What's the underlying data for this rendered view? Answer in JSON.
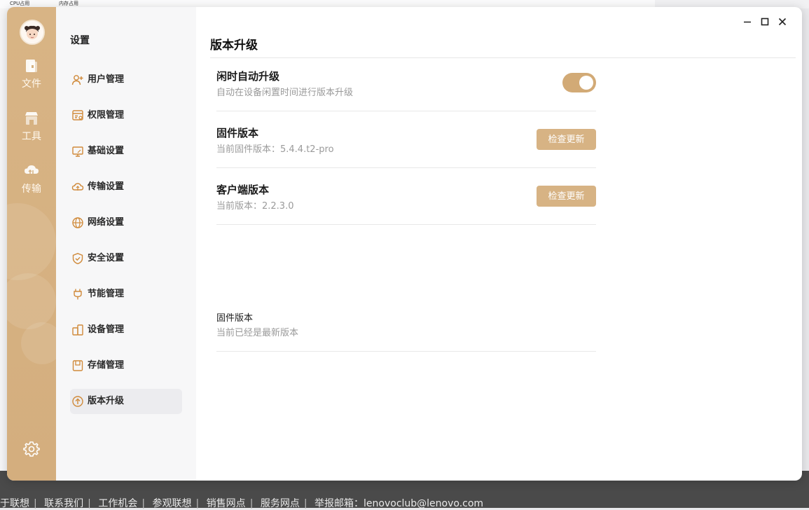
{
  "background": {
    "top_labels": [
      "CPU占用",
      "内存占用"
    ],
    "footer_links": [
      "于联想",
      "联系我们",
      "工作机会",
      "参观联想",
      "销售网点",
      "服务网点",
      "举报邮箱：lenovoclub@lenovo.com"
    ]
  },
  "rail": {
    "items": [
      {
        "label": "文件",
        "icon": "file-icon"
      },
      {
        "label": "工具",
        "icon": "shop-icon"
      },
      {
        "label": "传输",
        "icon": "cloud-transfer-icon"
      }
    ],
    "settings_icon": "gear-icon"
  },
  "sidebar": {
    "title": "设置",
    "items": [
      {
        "label": "用户管理",
        "icon": "user-add-icon"
      },
      {
        "label": "权限管理",
        "icon": "permission-icon"
      },
      {
        "label": "基础设置",
        "icon": "monitor-icon"
      },
      {
        "label": "传输设置",
        "icon": "cloud-icon"
      },
      {
        "label": "网络设置",
        "icon": "globe-icon"
      },
      {
        "label": "安全设置",
        "icon": "shield-icon"
      },
      {
        "label": "节能管理",
        "icon": "plug-icon"
      },
      {
        "label": "设备管理",
        "icon": "device-icon"
      },
      {
        "label": "存储管理",
        "icon": "storage-icon"
      },
      {
        "label": "版本升级",
        "icon": "upgrade-icon",
        "active": true
      }
    ]
  },
  "window_controls": [
    "minimize-icon",
    "maximize-icon",
    "close-icon"
  ],
  "main": {
    "title": "版本升级",
    "auto_upgrade": {
      "name": "闲时自动升级",
      "desc": "自动在设备闲置时间进行版本升级",
      "enabled": true
    },
    "firmware": {
      "name": "固件版本",
      "desc": "当前固件版本：5.4.4.t2-pro",
      "button": "检查更新"
    },
    "client": {
      "name": "客户端版本",
      "desc": "当前版本：2.2.3.0",
      "button": "检查更新"
    },
    "firmware_status": {
      "name": "固件版本",
      "desc": "当前已经是最新版本"
    }
  },
  "colors": {
    "accent": "#d7b384",
    "rail": "#d6b282",
    "toggle": "#d2aa76"
  }
}
